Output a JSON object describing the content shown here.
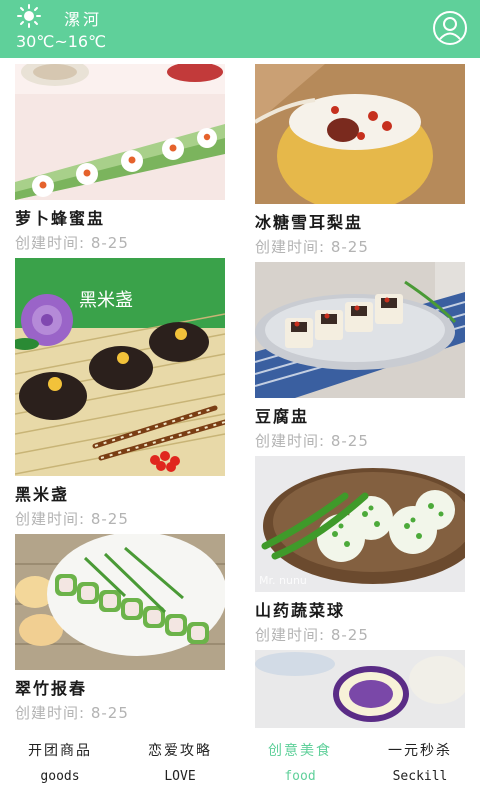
{
  "header": {
    "city": "漯河",
    "temperature": "30℃~16℃",
    "weather_icon": "sun-icon",
    "profile_icon": "user-icon"
  },
  "dishes_left": [
    {
      "title": "萝卜蜂蜜盅",
      "date": "创建时间: 8-25"
    },
    {
      "title": "黑米盏",
      "date": "创建时间: 8-25",
      "image_text": "黑米盏"
    },
    {
      "title": "翠竹报春",
      "date": "创建时间: 8-25"
    }
  ],
  "dishes_right": [
    {
      "title": "冰糖雪耳梨盅",
      "date": "创建时间: 8-25"
    },
    {
      "title": "豆腐盅",
      "date": "创建时间: 8-25"
    },
    {
      "title": "山药蔬菜球",
      "date": "创建时间: 8-25",
      "image_text": "Mr. nunu"
    },
    {
      "title": "",
      "date": ""
    }
  ],
  "nav": [
    {
      "cn": "开团商品",
      "en": "goods"
    },
    {
      "cn": "恋爱攻略",
      "en": "LOVE"
    },
    {
      "cn": "创意美食",
      "en": "food"
    },
    {
      "cn": "一元秒杀",
      "en": "Seckill"
    }
  ],
  "colors": {
    "accent": "#5fd09a",
    "date_gray": "#b3b3b3"
  }
}
